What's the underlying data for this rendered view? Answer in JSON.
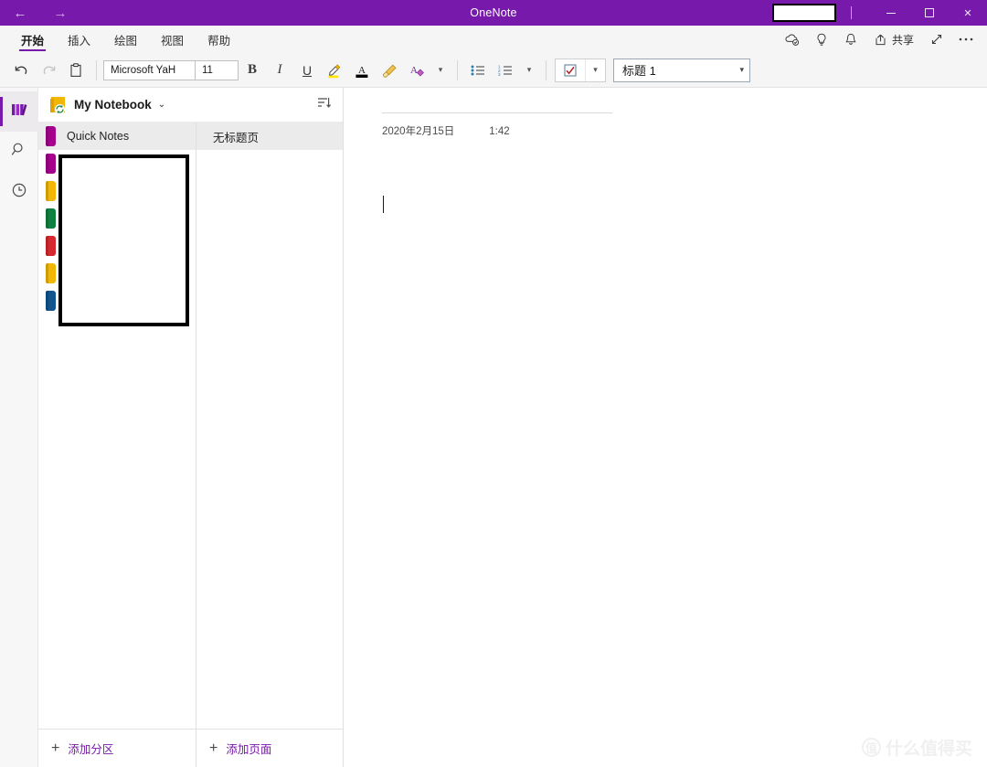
{
  "titlebar": {
    "app_title": "OneNote",
    "back_icon": "back-arrow-icon",
    "forward_icon": "forward-arrow-icon",
    "minimize_label": "",
    "maximize_label": "",
    "close_label": "✕",
    "accent_color": "#7719AA"
  },
  "ribbon": {
    "tabs": [
      {
        "label": "开始",
        "active": true
      },
      {
        "label": "插入",
        "active": false
      },
      {
        "label": "绘图",
        "active": false
      },
      {
        "label": "视图",
        "active": false
      },
      {
        "label": "帮助",
        "active": false
      }
    ],
    "share_label": "共享",
    "right_icons": [
      "cloud-sync-icon",
      "lightbulb-icon",
      "bell-icon",
      "share-icon",
      "fullscreen-icon",
      "more-options-icon"
    ]
  },
  "toolbar": {
    "undo_icon": "undo-icon",
    "redo_icon": "redo-icon",
    "clipboard_icon": "clipboard-icon",
    "font_name": "Microsoft YaH",
    "font_size": "11",
    "bold_label": "B",
    "italic_label": "I",
    "underline_label": "U",
    "highlight_icon": "highlighter-icon",
    "font_color_icon": "font-color-icon",
    "format_painter_icon": "format-painter-icon",
    "clear_format_icon": "clear-formatting-icon",
    "bullets_icon": "bullet-list-icon",
    "numbering_icon": "numbered-list-icon",
    "tag_icon": "todo-checkbox-icon",
    "style_value": "标题 1",
    "highlight_color": "#FFE700",
    "font_color": "#000000"
  },
  "rail": {
    "items": [
      {
        "name": "notebooks",
        "icon": "notebooks-icon",
        "active": true
      },
      {
        "name": "search",
        "icon": "search-icon",
        "active": false
      },
      {
        "name": "recent",
        "icon": "clock-icon",
        "active": false
      }
    ]
  },
  "notebook": {
    "name": "My Notebook",
    "chevron": "⌄",
    "sort_icon": "sort-icon",
    "sync_icon": "sync-badge-icon"
  },
  "sections": {
    "items": [
      {
        "label": "Quick Notes",
        "color": "#A4008C",
        "selected": true
      },
      {
        "label": "",
        "color": "#A4008C",
        "selected": false
      },
      {
        "label": "",
        "color": "#F2B705",
        "selected": false
      },
      {
        "label": "",
        "color": "#0E8040",
        "selected": false
      },
      {
        "label": "",
        "color": "#D7282F",
        "selected": false
      },
      {
        "label": "",
        "color": "#F2B705",
        "selected": false
      },
      {
        "label": "",
        "color": "#10558E",
        "selected": false
      }
    ],
    "add_label": "添加分区"
  },
  "pages": {
    "items": [
      {
        "label": "无标题页",
        "selected": true
      }
    ],
    "add_label": "添加页面"
  },
  "canvas": {
    "page_title": "",
    "date": "2020年2月15日",
    "time": "1:42"
  },
  "watermark": {
    "mark": "值",
    "text": "什么值得买"
  }
}
